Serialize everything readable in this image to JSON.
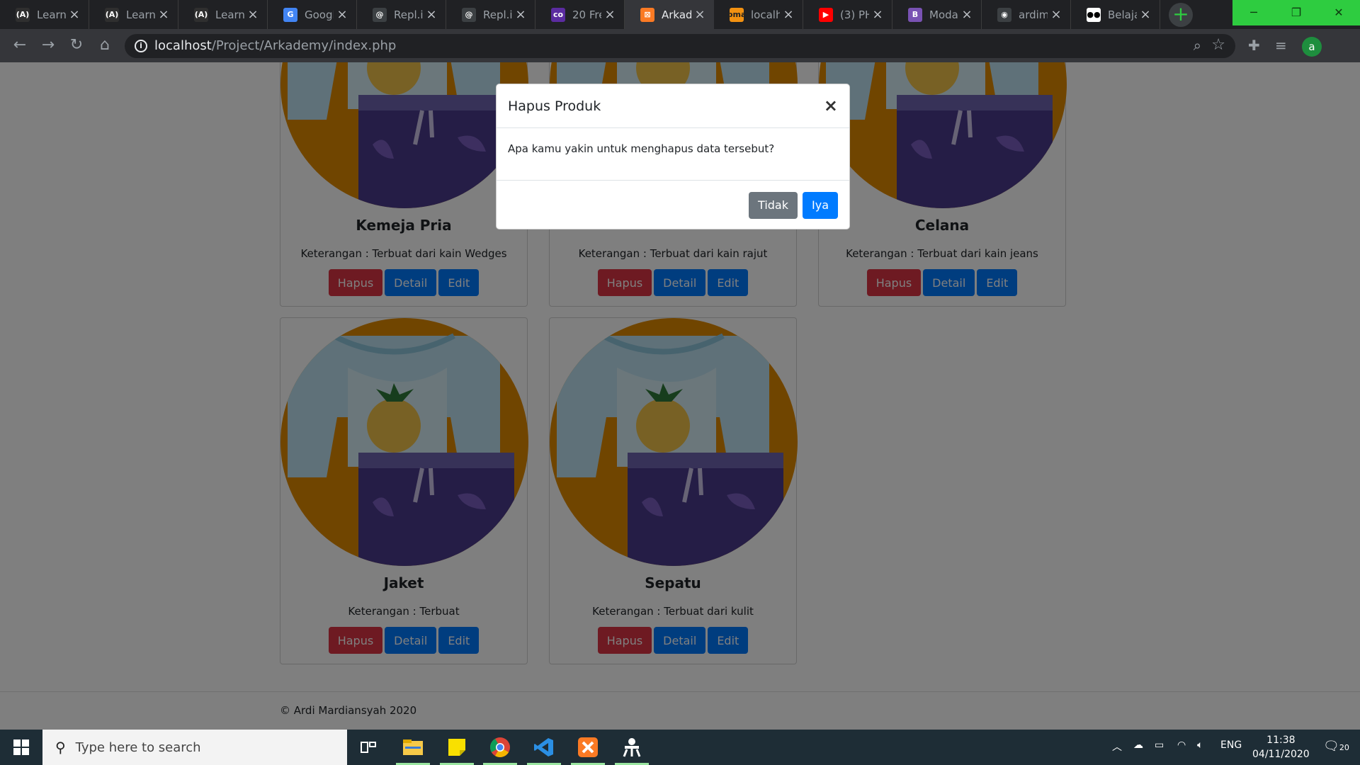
{
  "browser": {
    "tabs": [
      {
        "label": "Learn /",
        "favicon": "(A)",
        "icon": "angular-learn-icon"
      },
      {
        "label": "Learn E",
        "favicon": "(A)",
        "icon": "angular-learn-icon"
      },
      {
        "label": "Learn t",
        "favicon": "(A)",
        "icon": "angular-learn-icon"
      },
      {
        "label": "Googl",
        "favicon": "G",
        "icon": "google-translate-icon"
      },
      {
        "label": "Repl.it",
        "favicon": "@",
        "icon": "replit-icon"
      },
      {
        "label": "Repl.it",
        "favicon": "@",
        "icon": "replit-icon"
      },
      {
        "label": "20 Fre",
        "favicon": "co",
        "icon": "colorlib-icon"
      },
      {
        "label": "Arkade",
        "favicon": "⊠",
        "icon": "xampp-icon",
        "active": true
      },
      {
        "label": "localhc",
        "favicon": "pma",
        "icon": "phpmyadmin-icon"
      },
      {
        "label": "(3) PH",
        "favicon": "▶",
        "icon": "youtube-icon"
      },
      {
        "label": "Modal",
        "favicon": "B",
        "icon": "bootstrap-icon"
      },
      {
        "label": "ardimr",
        "favicon": "◉",
        "icon": "github-icon"
      },
      {
        "label": "Belajar",
        "favicon": "●●",
        "icon": "medium-icon"
      }
    ],
    "new_tab": "+",
    "window_controls": {
      "minimize": "─",
      "restore": "❐",
      "close": "✕"
    },
    "url_host": "localhost",
    "url_path": "/Project/Arkademy/index.php",
    "profile_initial": "a"
  },
  "products": [
    {
      "title": "Kemeja Pria",
      "desc": "Keterangan : Terbuat dari kain Wedges"
    },
    {
      "title": "",
      "desc": "Keterangan : Terbuat dari kain rajut"
    },
    {
      "title": "Celana",
      "desc": "Keterangan : Terbuat dari kain jeans"
    },
    {
      "title": "Jaket",
      "desc": "Keterangan : Terbuat"
    },
    {
      "title": "Sepatu",
      "desc": "Keterangan : Terbuat dari kulit"
    }
  ],
  "card_buttons": {
    "hapus": "Hapus",
    "detail": "Detail",
    "edit": "Edit"
  },
  "footer": "© Ardi Mardiansyah 2020",
  "modal": {
    "title": "Hapus Produk",
    "close": "×",
    "body": "Apa kamu yakin untuk menghapus data tersebut?",
    "cancel": "Tidak",
    "confirm": "Iya"
  },
  "taskbar": {
    "search_placeholder": "Type here to search",
    "language": "ENG",
    "time": "11:38",
    "date": "04/11/2020",
    "notification_count": "20"
  },
  "colors": {
    "danger": "#dc3545",
    "primary": "#007bff",
    "secondary": "#6c757d",
    "illustration_orange": "#e08a00",
    "illustration_purple": "#4a3a8c",
    "illustration_shirt": "#bfe3f2"
  }
}
